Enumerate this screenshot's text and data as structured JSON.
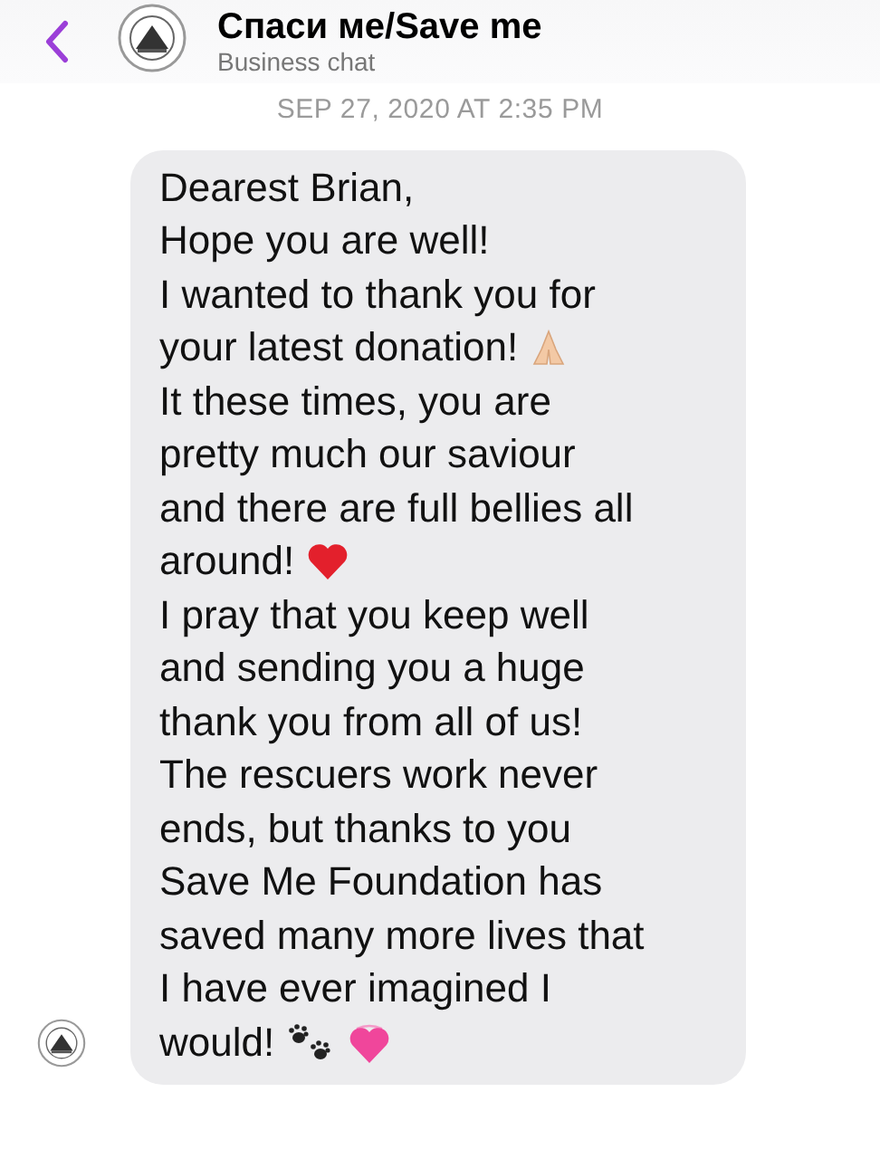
{
  "header": {
    "title": "Спаси ме/Save me",
    "subtitle": "Business chat"
  },
  "timestamp": "SEP 27, 2020 AT 2:35 PM",
  "message": {
    "lines": [
      {
        "text": "Dearest Brian,"
      },
      {
        "text": "Hope you are well!"
      },
      {
        "text": "I wanted to thank you for"
      },
      {
        "text": "your latest donation!",
        "icons": [
          {
            "kind": "hands"
          }
        ]
      },
      {
        "text": "It these times, you are"
      },
      {
        "text": "pretty much our saviour"
      },
      {
        "text": "and there are full bellies all"
      },
      {
        "text": "around!",
        "icons": [
          {
            "kind": "heart"
          }
        ]
      },
      {
        "text": "I pray that you keep well"
      },
      {
        "text": "and sending you a huge"
      },
      {
        "text": "thank you from all of us!"
      },
      {
        "text": "The rescuers work never"
      },
      {
        "text": "ends, but thanks to you"
      },
      {
        "text": "Save Me Foundation has"
      },
      {
        "text": "saved many more lives that"
      },
      {
        "text": "I have ever imagined I"
      },
      {
        "text": "would!",
        "icons": [
          {
            "kind": "paws"
          },
          {
            "kind": "sparkle-heart"
          }
        ]
      }
    ]
  }
}
